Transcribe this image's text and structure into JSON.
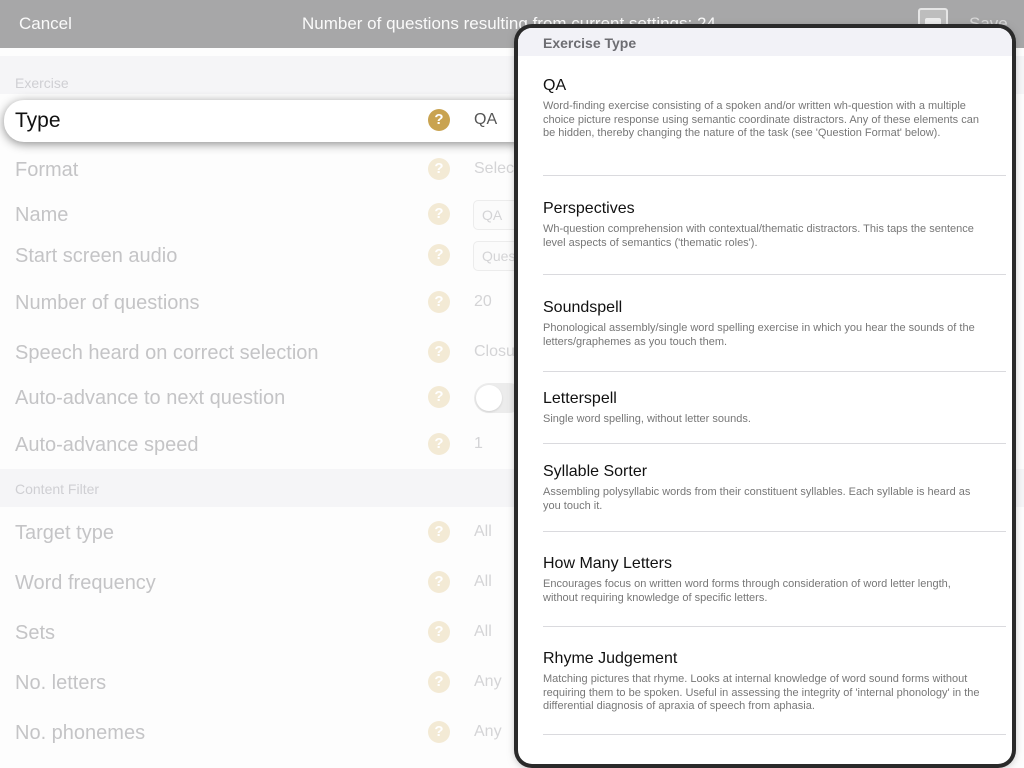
{
  "nav": {
    "cancel": "Cancel",
    "title": "Number of questions resulting from current settings: 24",
    "save": "Save",
    "icon": "image-icon"
  },
  "sections": {
    "exercise": "Exercise",
    "content_filter": "Content Filter"
  },
  "fields": {
    "type": {
      "label": "Type",
      "value": "QA"
    },
    "format": {
      "label": "Format",
      "value": "Select"
    },
    "name": {
      "label": "Name",
      "value": "QA"
    },
    "start_audio": {
      "label": "Start screen audio",
      "value": "Questio"
    },
    "num_questions": {
      "label": "Number of questions",
      "value": "20"
    },
    "speech_correct": {
      "label": "Speech heard on correct selection",
      "value": "Closure"
    },
    "auto_advance": {
      "label": "Auto-advance to next question",
      "value": false
    },
    "auto_speed": {
      "label": "Auto-advance speed",
      "value": "1"
    },
    "target_type": {
      "label": "Target type",
      "value": "All"
    },
    "word_freq": {
      "label": "Word frequency",
      "value": "All"
    },
    "sets": {
      "label": "Sets",
      "value": "All"
    },
    "letters": {
      "label": "No. letters",
      "value": "Any"
    },
    "phonemes": {
      "label": "No. phonemes",
      "value": "Any"
    }
  },
  "help_glyph": "?",
  "colors": {
    "help_active": "#c9a350",
    "help_dim": "#f3ead5",
    "nav_bg": "#a7a7a8"
  },
  "popover": {
    "header": "Exercise Type",
    "options": [
      {
        "title": "QA",
        "desc": "Word-finding exercise consisting of a spoken and/or written wh-question with a multiple choice picture response using semantic coordinate distractors. Any of these elements can be hidden, thereby changing the nature of the task (see 'Question Format' below)."
      },
      {
        "title": "Perspectives",
        "desc": "Wh-question comprehension with contextual/thematic distractors. This taps the sentence level aspects of semantics ('thematic roles')."
      },
      {
        "title": "Soundspell",
        "desc": "Phonological assembly/single word spelling exercise in which you hear the sounds of the letters/graphemes as you touch them."
      },
      {
        "title": "Letterspell",
        "desc": "Single word spelling, without letter sounds."
      },
      {
        "title": "Syllable Sorter",
        "desc": "Assembling polysyllabic words from their constituent syllables. Each syllable is heard as you touch it."
      },
      {
        "title": "How Many Letters",
        "desc": "Encourages focus on written word forms through consideration of word letter length, without requiring knowledge of specific letters."
      },
      {
        "title": "Rhyme Judgement",
        "desc": "Matching pictures that rhyme. Looks at internal knowledge of word sound forms without requiring them to be spoken. Useful in assessing the integrity of 'internal phonology' in the differential diagnosis of apraxia of speech from aphasia."
      }
    ]
  }
}
